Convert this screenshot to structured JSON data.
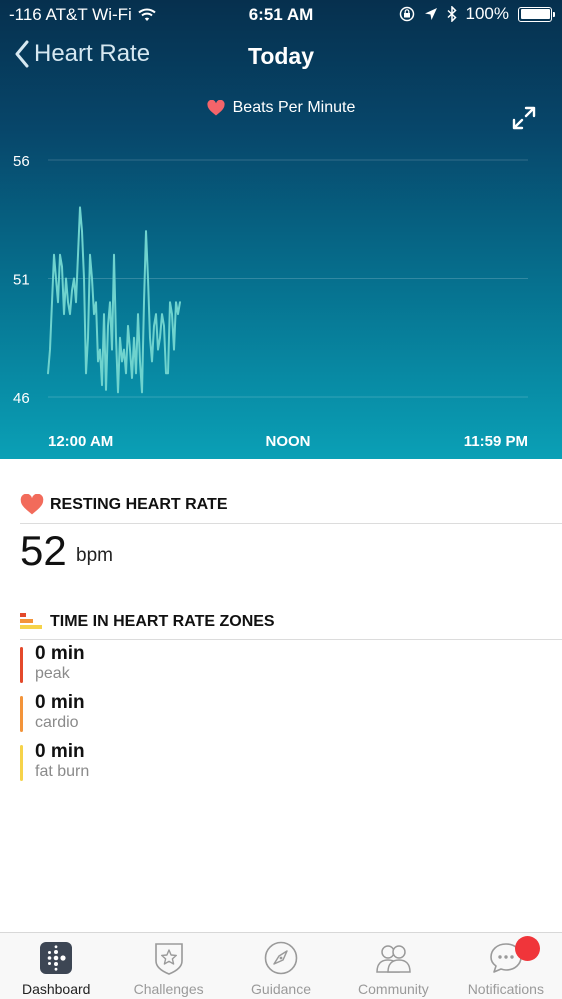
{
  "status_bar": {
    "carrier": "-116 AT&T Wi-Fi",
    "time": "6:51 AM",
    "battery": "100%"
  },
  "nav": {
    "back_label": "Heart Rate",
    "title": "Today"
  },
  "chart_data": {
    "type": "line",
    "title": "Beats Per Minute",
    "x_tick_labels": [
      "12:00 AM",
      "NOON",
      "11:59 PM"
    ],
    "y_tick_labels": [
      "56",
      "51",
      "46"
    ],
    "xlim_hours": [
      0,
      24
    ],
    "ylim": [
      46,
      56
    ],
    "grid": true,
    "series": [
      {
        "color": "#6fd3ce",
        "x_hours": [
          0.0,
          0.1,
          0.2,
          0.3,
          0.4,
          0.5,
          0.6,
          0.7,
          0.8,
          0.9,
          1.0,
          1.1,
          1.2,
          1.3,
          1.4,
          1.5,
          1.6,
          1.7,
          1.8,
          1.9,
          2.0,
          2.1,
          2.2,
          2.3,
          2.4,
          2.5,
          2.6,
          2.7,
          2.8,
          2.9,
          3.0,
          3.1,
          3.2,
          3.3,
          3.4,
          3.5,
          3.6,
          3.7,
          3.8,
          3.9,
          4.0,
          4.1,
          4.2,
          4.3,
          4.4,
          4.5,
          4.6,
          4.7,
          4.8,
          4.9,
          5.0,
          5.1,
          5.2,
          5.3,
          5.4,
          5.5,
          5.6,
          5.7,
          5.8,
          5.9,
          6.0,
          6.1,
          6.2,
          6.3,
          6.4,
          6.5,
          6.6
        ],
        "values": [
          47.0,
          48.0,
          50.0,
          52.0,
          51.0,
          50.0,
          52.0,
          51.5,
          49.5,
          51.0,
          50.0,
          49.5,
          50.5,
          51.0,
          50.0,
          52.0,
          54.0,
          53.0,
          51.0,
          47.0,
          48.5,
          52.0,
          51.0,
          49.5,
          50.0,
          47.5,
          48.0,
          46.5,
          49.5,
          46.3,
          49.0,
          50.0,
          48.0,
          52.0,
          48.5,
          46.2,
          48.5,
          47.5,
          48.0,
          47.0,
          49.0,
          48.0,
          46.8,
          48.5,
          47.0,
          49.5,
          47.5,
          46.2,
          50.0,
          53.0,
          51.0,
          48.5,
          47.5,
          49.0,
          49.5,
          48.0,
          48.5,
          49.5,
          49.0,
          47.0,
          47.0,
          50.0,
          49.5,
          48.0,
          50.0,
          49.5,
          50.0
        ]
      }
    ]
  },
  "resting": {
    "title": "RESTING HEART RATE",
    "value": "52",
    "unit": "bpm"
  },
  "zones": {
    "title": "TIME IN HEART RATE ZONES",
    "items": [
      {
        "minutes": "0 min",
        "name": "peak",
        "color": "#e4492b"
      },
      {
        "minutes": "0 min",
        "name": "cardio",
        "color": "#f3943a"
      },
      {
        "minutes": "0 min",
        "name": "fat burn",
        "color": "#f6d34a"
      }
    ]
  },
  "tabs": [
    {
      "label": "Dashboard",
      "icon": "dashboard-icon",
      "active": true
    },
    {
      "label": "Challenges",
      "icon": "challenges-icon"
    },
    {
      "label": "Guidance",
      "icon": "compass-icon"
    },
    {
      "label": "Community",
      "icon": "community-icon"
    },
    {
      "label": "Notifications",
      "icon": "notifications-icon"
    }
  ],
  "colors": {
    "heart": "#f4646a",
    "accent_line": "#6fd3ce",
    "notification_badge": "#f0353a"
  }
}
